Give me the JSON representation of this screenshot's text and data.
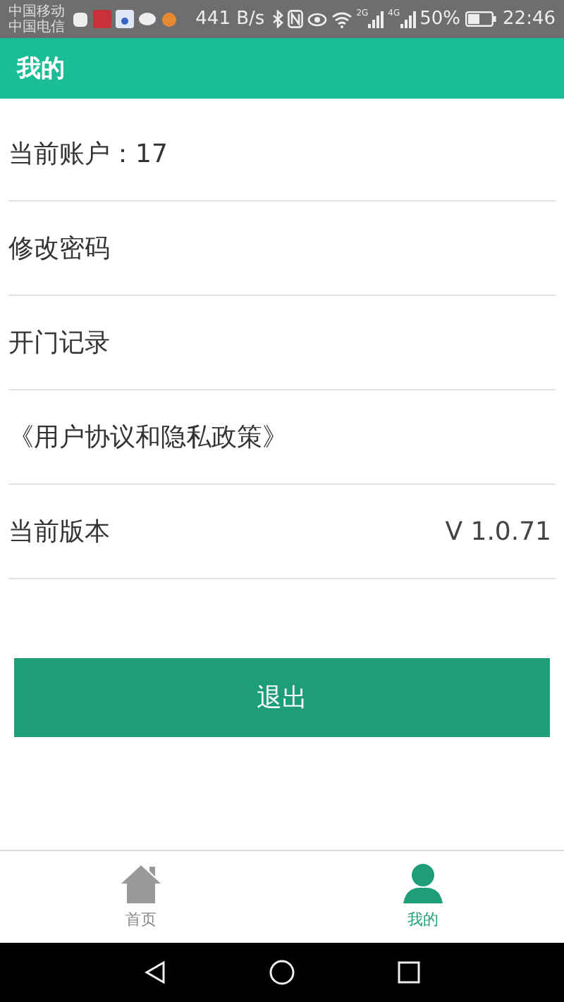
{
  "status_bar": {
    "carriers": [
      "中国移动",
      "中国电信"
    ],
    "speed": "441 B/s",
    "signal_labels": [
      "2G",
      "4G"
    ],
    "battery_text": "50%",
    "time": "22:46"
  },
  "header": {
    "title": "我的"
  },
  "rows": [
    {
      "label": "当前账户：17"
    },
    {
      "label": "修改密码"
    },
    {
      "label": "开门记录"
    },
    {
      "label": "《用户协议和隐私政策》"
    },
    {
      "label": "当前版本",
      "value": "V 1.0.71"
    }
  ],
  "logout_button": "退出",
  "bottom_nav": [
    {
      "label": "首页",
      "kind": "home",
      "selected": false
    },
    {
      "label": "我的",
      "kind": "profile",
      "selected": true
    }
  ]
}
